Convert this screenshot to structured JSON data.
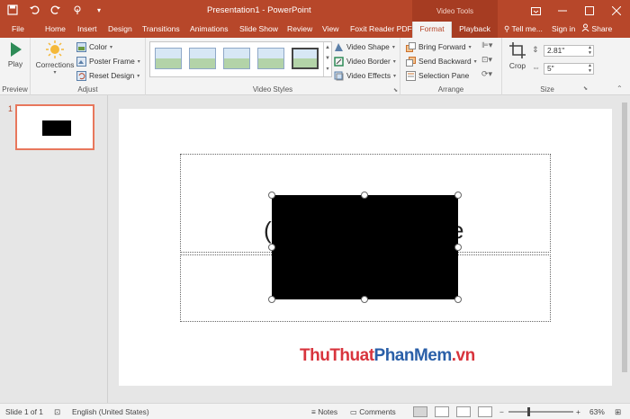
{
  "app": {
    "window_title": "Presentation1 - PowerPoint",
    "context_group": "Video Tools",
    "qat": [
      "save-icon",
      "undo-icon",
      "redo-icon",
      "touch-mode-icon",
      "customize-icon"
    ],
    "winctl": [
      "ribbon-options-icon",
      "minimize-icon",
      "maximize-icon",
      "close-icon"
    ]
  },
  "tabs": [
    "File",
    "Home",
    "Insert",
    "Design",
    "Transitions",
    "Animations",
    "Slide Show",
    "Review",
    "View",
    "Foxit Reader PDF",
    "Format",
    "Playback"
  ],
  "active_tab": "Format",
  "tell_me": "Tell me...",
  "sign_in": "Sign in",
  "share": "Share",
  "ribbon": {
    "preview": {
      "label": "Preview",
      "play": "Play"
    },
    "adjust": {
      "label": "Adjust",
      "corrections": "Corrections",
      "color": "Color",
      "poster_frame": "Poster Frame",
      "reset_design": "Reset Design"
    },
    "video_styles": {
      "label": "Video Styles",
      "video_shape": "Video Shape",
      "video_border": "Video Border",
      "video_effects": "Video Effects"
    },
    "arrange": {
      "label": "Arrange",
      "bring_forward": "Bring Forward",
      "send_backward": "Send Backward",
      "selection_pane": "Selection Pane"
    },
    "size": {
      "label": "Size",
      "crop": "Crop",
      "height": "2.81\"",
      "width": "5\""
    }
  },
  "slides": [
    {
      "number": "1"
    }
  ],
  "slide": {
    "title_partial_left": "(",
    "title_partial_right": "e"
  },
  "watermark": {
    "part1": "ThuThuat",
    "part2": "PhanMem",
    "part3": ".vn"
  },
  "status": {
    "slide_of": "Slide 1 of 1",
    "language": "English (United States)",
    "notes": "Notes",
    "comments": "Comments",
    "zoom": "63%"
  },
  "colors": {
    "accent": "#b7472a",
    "context": "#a63c22"
  }
}
